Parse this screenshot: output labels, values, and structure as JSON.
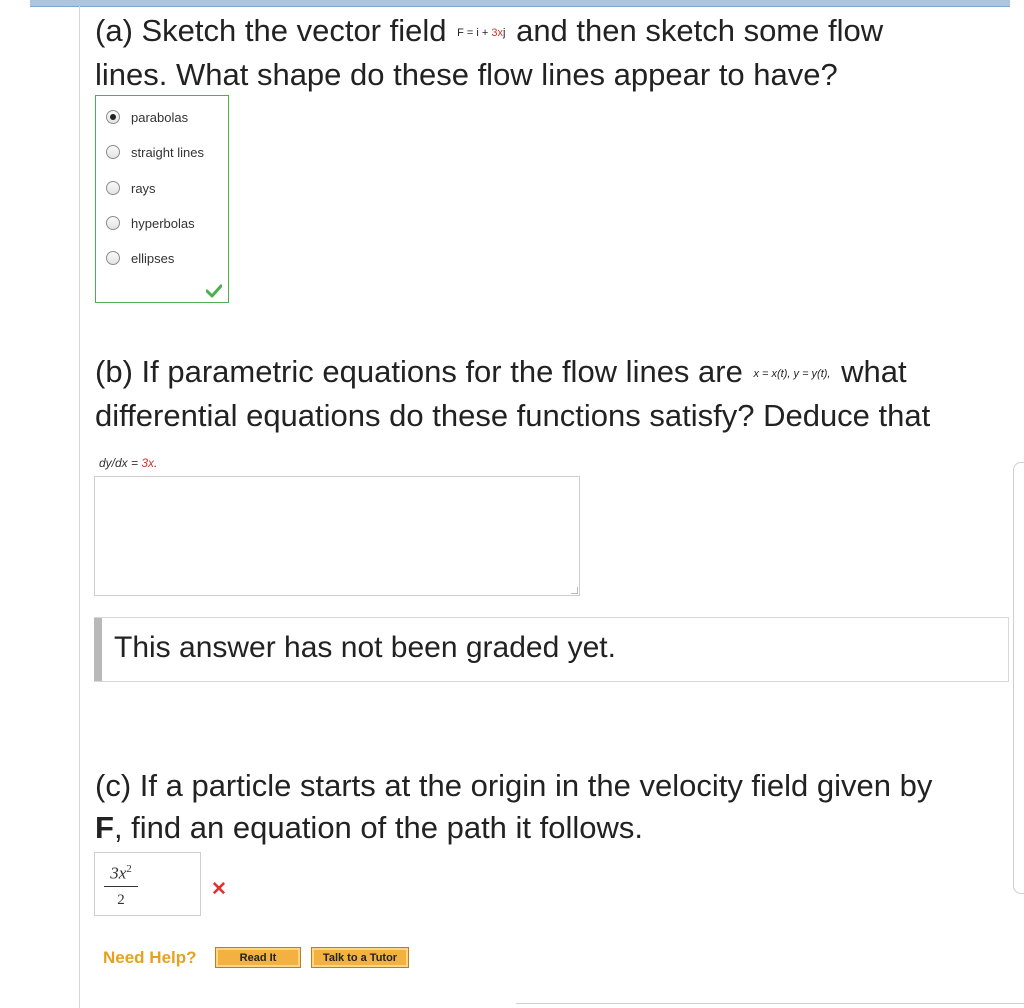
{
  "part_a": {
    "q_before": "(a) Sketch the vector field",
    "math_prefix": "F = i + ",
    "math_red": "3x",
    "math_suffix": "j",
    "q_after": "and then sketch some flow",
    "q_line2": "lines. What shape do these flow lines appear to have?",
    "choices": [
      {
        "label": "parabolas",
        "selected": true
      },
      {
        "label": "straight lines",
        "selected": false
      },
      {
        "label": "rays",
        "selected": false
      },
      {
        "label": "hyperbolas",
        "selected": false
      },
      {
        "label": "ellipses",
        "selected": false
      }
    ],
    "result": "correct"
  },
  "part_b": {
    "q_before": "(b) If parametric equations for the flow lines are",
    "math": "x = x(t), y = y(t),",
    "q_after": "what",
    "q_line2": "differential equations do these functions satisfy? Deduce that",
    "hint_prefix": "dy/dx = ",
    "hint_red": "3x",
    "hint_suffix": ".",
    "answer_value": "",
    "graded_text": "This answer has not been graded yet."
  },
  "part_c": {
    "q_line1": "(c) If a particle starts at the origin in the velocity field given by",
    "q_line2_bold": "F",
    "q_line2_rest": ", find an equation of the path it follows.",
    "answer_numerator": "3x",
    "answer_exponent": "2",
    "answer_denominator": "2",
    "result": "incorrect"
  },
  "help": {
    "need_help": "Need Help?",
    "read_it": "Read It",
    "talk_tutor": "Talk to a Tutor"
  },
  "colors": {
    "correct": "#4caf50",
    "incorrect": "#e03030",
    "help": "#e6a21e",
    "button": "#f2b141"
  }
}
